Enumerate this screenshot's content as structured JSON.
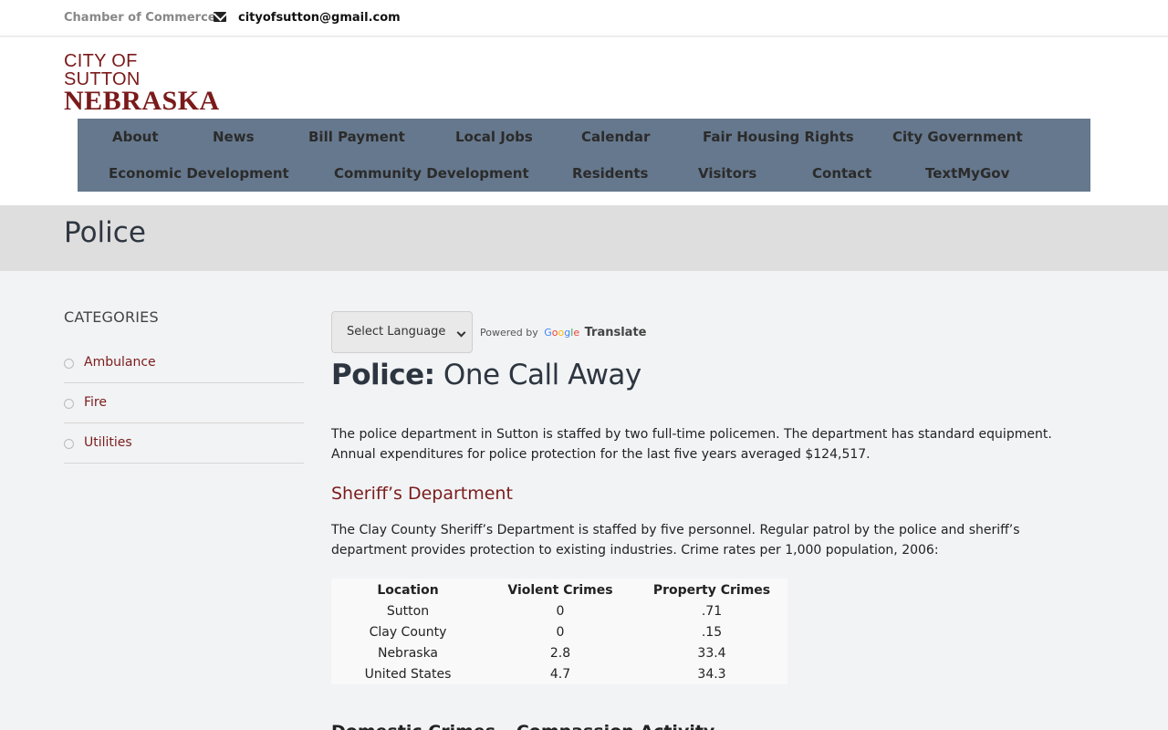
{
  "topbar": {
    "chamber": "Chamber of Commerce",
    "email": "cityofsutton@gmail.com"
  },
  "logo": {
    "line1": "CITY OF SUTTON",
    "line2": "NEBRASKA"
  },
  "nav": {
    "items": [
      "About",
      "News",
      "Bill Payment",
      "Local Jobs",
      "Calendar",
      "Fair Housing Rights",
      "City Government",
      "Economic Development",
      "Community Development",
      "Residents",
      "Visitors",
      "Contact",
      "TextMyGov"
    ]
  },
  "page": {
    "title": "Police"
  },
  "sidebar": {
    "heading": "CATEGORIES",
    "items": [
      "Ambulance",
      "Fire",
      "Utilities"
    ]
  },
  "translate": {
    "select_label": "Select Language",
    "powered_by": "Powered by",
    "google": "Google",
    "translate": "Translate"
  },
  "content": {
    "headline_strong": "Police:",
    "headline_light": " One Call Away",
    "para1": "The police department in Sutton is staffed by two full-time policemen. The department has standard equipment. Annual expenditures for police protection for the last five years averaged $124,517.",
    "subhead": "Sheriff’s Department",
    "para2": "The Clay County Sheriff’s Department is staffed by five personnel. Regular patrol by the police and sheriff’s department provides protection to existing industries. Crime rates per 1,000 population, 2006:",
    "next_heading": "Domestic Crimes – Compassion Activity"
  },
  "table": {
    "headers": [
      "Location",
      "Violent Crimes",
      "Property Crimes"
    ],
    "rows": [
      [
        "Sutton",
        "0",
        ".71"
      ],
      [
        "Clay County",
        "0",
        ".15"
      ],
      [
        "Nebraska",
        "2.8",
        "33.4"
      ],
      [
        "United States",
        "4.7",
        "34.3"
      ]
    ]
  },
  "colors": {
    "nav_bg": "#66788d",
    "accent": "#7b1c1c",
    "title_band": "#dedede"
  }
}
